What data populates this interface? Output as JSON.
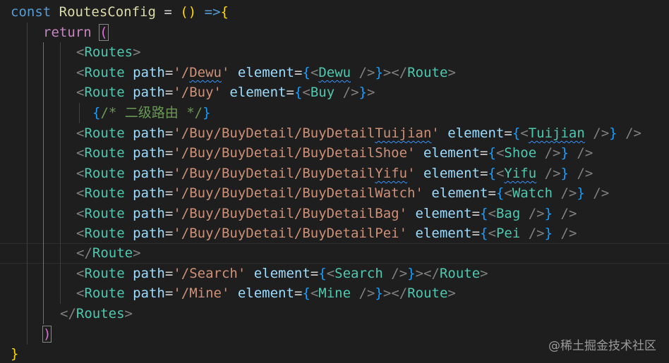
{
  "editor": {
    "theme_background": "#1e1e1e",
    "decl_keyword": "const",
    "component_name": "RoutesConfig",
    "assign": "=",
    "params": "()",
    "arrow": "=>",
    "open_brace": "{",
    "return_keyword": "return",
    "open_paren": "(",
    "close_paren": ")",
    "close_brace": "}",
    "lt": "<",
    "gt": ">",
    "lt_slash": "</",
    "self_close": "/>",
    "eq": "=",
    "attr_path": "path",
    "attr_element": "element",
    "routes_tag": "Routes",
    "route_tag": "Route",
    "comment_text": "/* 二级路由 */",
    "routes": [
      {
        "path": "'/Dewu'",
        "component": "Dewu"
      },
      {
        "path": "'/Buy'",
        "component": "Buy"
      },
      {
        "path": "'/Buy/BuyDetail/BuyDetailTuijian'",
        "component": "Tuijian"
      },
      {
        "path": "'/Buy/BuyDetail/BuyDetailShoe'",
        "component": "Shoe"
      },
      {
        "path": "'/Buy/BuyDetail/BuyDetailYifu'",
        "component": "Yifu"
      },
      {
        "path": "'/Buy/BuyDetail/BuyDetailWatch'",
        "component": "Watch"
      },
      {
        "path": "'/Buy/BuyDetail/BuyDetailBag'",
        "component": "Bag"
      },
      {
        "path": "'/Buy/BuyDetail/BuyDetailPei'",
        "component": "Pei"
      },
      {
        "path": "'/Search'",
        "component": "Search"
      },
      {
        "path": "'/Mine'",
        "component": "Mine"
      }
    ]
  },
  "watermark": "@稀土掘金技术社区",
  "colors": {
    "keyword": "#569cd6",
    "control": "#c586c0",
    "function": "#dcdcaa",
    "tag": "#4ec9b0",
    "attribute": "#9cdcfe",
    "string": "#ce9178",
    "punctuation": "#808080",
    "comment": "#6a9955",
    "bracket_level1": "#ffd700",
    "bracket_level2": "#da70d6",
    "bracket_level3": "#179fff",
    "squiggle": "#3794ff"
  }
}
